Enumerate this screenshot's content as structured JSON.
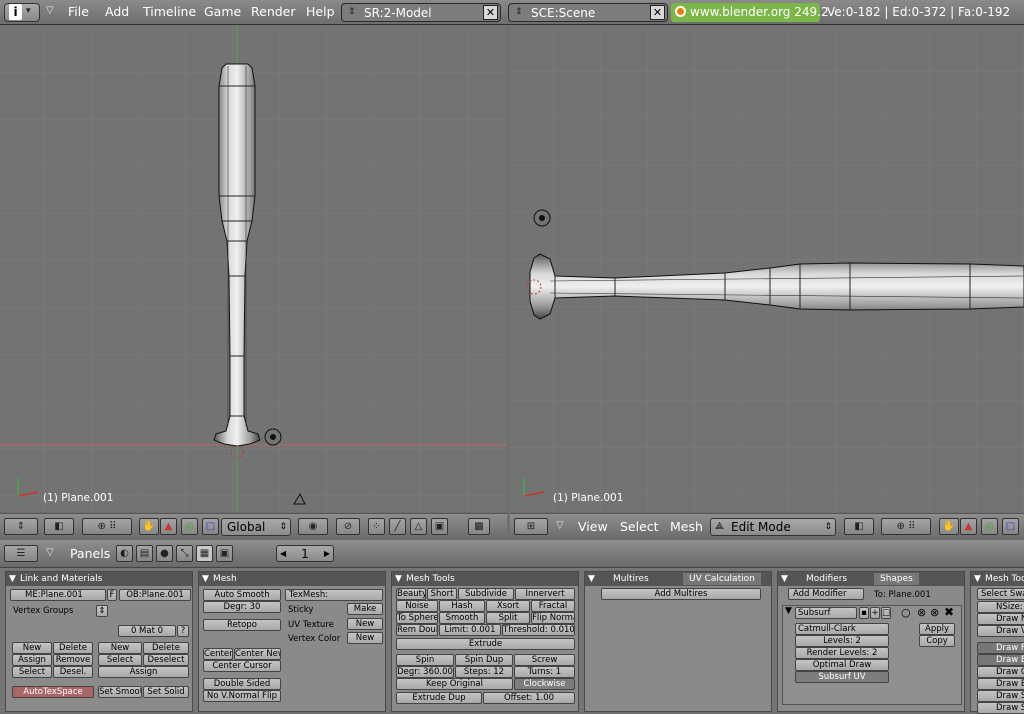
{
  "topbar": {
    "menus": [
      "File",
      "Add",
      "Timeline",
      "Game",
      "Render",
      "Help"
    ],
    "screen": "SR:2-Model",
    "scene": "SCE:Scene",
    "url": "www.blender.org 249.2",
    "stats": "Ve:0-182 | Ed:0-372 | Fa:0-192"
  },
  "left_view": {
    "object_label": "(1) Plane.001",
    "transform": "Global"
  },
  "right_view": {
    "object_label": "(1) Plane.001",
    "menus": [
      "View",
      "Select",
      "Mesh"
    ],
    "mode": "Edit Mode"
  },
  "buttons_header": {
    "panels_label": "Panels",
    "frame": "1"
  },
  "link_materials": {
    "title": "Link and Materials",
    "mesh_name": "ME:Plane.001",
    "f_label": "F",
    "object_name": "OB:Plane.001",
    "vertex_groups": "Vertex Groups",
    "mat_slot": "0 Mat 0",
    "q_mark": "?",
    "buttons": [
      "New",
      "Delete",
      "Assign",
      "Remove",
      "Select",
      "Desel.",
      "New",
      "Delete",
      "Select",
      "Deselect",
      "Assign"
    ],
    "autotex": "AutoTexSpace",
    "set_smooth": "Set Smoot",
    "set_solid": "Set Solid"
  },
  "mesh": {
    "title": "Mesh",
    "auto_smooth": "Auto Smooth",
    "degr": "Degr: 30",
    "retopo": "Retopo",
    "texmesh": "TexMesh:",
    "sticky": "Sticky",
    "make": "Make",
    "uv_texture": "UV Texture",
    "vertex_color": "Vertex Color",
    "new1": "New",
    "new2": "New",
    "center": "Center",
    "center_new": "Center New",
    "center_cursor": "Center Cursor",
    "double_sided": "Double Sided",
    "no_vnormal_flip": "No V.Normal Flip"
  },
  "mesh_tools": {
    "title": "Mesh Tools",
    "row1": [
      "Beauty",
      "Short",
      "Subdivide",
      "Innervert"
    ],
    "row2": [
      "Noise",
      "Hash",
      "Xsort",
      "Fractal"
    ],
    "row3": [
      "To Sphere",
      "Smooth",
      "Split",
      "Flip Normal"
    ],
    "rem_doubles": "Rem Doubl",
    "limit": "Limit: 0.001",
    "threshold": "Threshold: 0.010",
    "extrude": "Extrude",
    "row5": [
      "Spin",
      "Spin Dup",
      "Screw"
    ],
    "degr": "Degr: 360.00",
    "steps": "Steps: 12",
    "turns": "Turns: 1",
    "keep_original": "Keep Original",
    "clockwise": "Clockwise",
    "extrude_dup": "Extrude Dup",
    "offset": "Offset: 1.00"
  },
  "multires": {
    "title": "Multires",
    "tab": "UV Calculation",
    "add": "Add Multires"
  },
  "modifiers": {
    "title": "Modifiers",
    "tab": "Shapes",
    "add": "Add Modifier",
    "to": "To: Plane.001",
    "name": "Subsurf",
    "type": "Catmull-Clark",
    "levels": "Levels: 2",
    "render_levels": "Render Levels: 2",
    "optimal": "Optimal Draw",
    "subsurf_uv": "Subsurf UV",
    "apply": "Apply",
    "copy": "Copy"
  },
  "mesh_tools_more": {
    "title": "Mesh Too",
    "items": [
      "Select Swa",
      "NSize:",
      "Draw No",
      "Draw VN",
      "Draw F",
      "Draw E",
      "Draw Cr",
      "Draw Beve",
      "Draw Se",
      "Draw Sh"
    ]
  },
  "colors": {
    "bg": "#737373",
    "grid": "#7d7d7d",
    "axis_red": "#b86a6a",
    "axis_green": "#5fa35f",
    "header": "#7c7c7c"
  }
}
